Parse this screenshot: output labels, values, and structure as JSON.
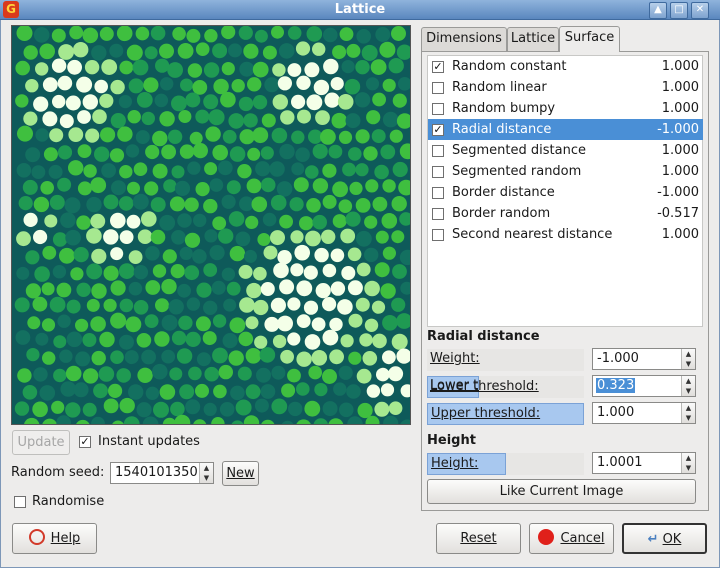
{
  "window": {
    "title": "Lattice",
    "app_icon": "G"
  },
  "controls": {
    "update_label": "Update",
    "instant_updates_label": "Instant updates",
    "instant_updates_checked": true,
    "seed_label": "Random seed:",
    "seed_value": "1540101350",
    "new_label": "New",
    "randomise_label": "Randomise",
    "randomise_checked": false
  },
  "tabs": [
    "Dimensions",
    "Lattice",
    "Surface"
  ],
  "active_tab": "Surface",
  "surface_list": [
    {
      "label": "Random constant",
      "value": "1.000",
      "checked": true
    },
    {
      "label": "Random linear",
      "value": "1.000",
      "checked": false
    },
    {
      "label": "Random bumpy",
      "value": "1.000",
      "checked": false
    },
    {
      "label": "Radial distance",
      "value": "-1.000",
      "checked": true,
      "selected": true
    },
    {
      "label": "Segmented distance",
      "value": "1.000",
      "checked": false
    },
    {
      "label": "Segmented random",
      "value": "1.000",
      "checked": false
    },
    {
      "label": "Border distance",
      "value": "-1.000",
      "checked": false
    },
    {
      "label": "Border random",
      "value": "-0.517",
      "checked": false
    },
    {
      "label": "Second nearest distance",
      "value": "1.000",
      "checked": false
    }
  ],
  "radial": {
    "header": "Radial distance",
    "weight_label": "Weight:",
    "weight_value": "-1.000",
    "lower_label": "Lower threshold:",
    "lower_value": "0.323",
    "upper_label": "Upper threshold:",
    "upper_value": "1.000"
  },
  "height": {
    "header": "Height",
    "height_label": "Height:",
    "height_value": "1.0001",
    "like_current_label": "Like Current Image"
  },
  "footer": {
    "help_label": "Help",
    "reset_label": "Reset",
    "cancel_label": "Cancel",
    "ok_label": "OK"
  },
  "colors": {
    "titlebar": "#6f97c9",
    "selection": "#4a8fd6",
    "preview_dark": "#0e5a5a",
    "preview_green": "#3fbf3f",
    "preview_light": "#f4ffe8"
  }
}
